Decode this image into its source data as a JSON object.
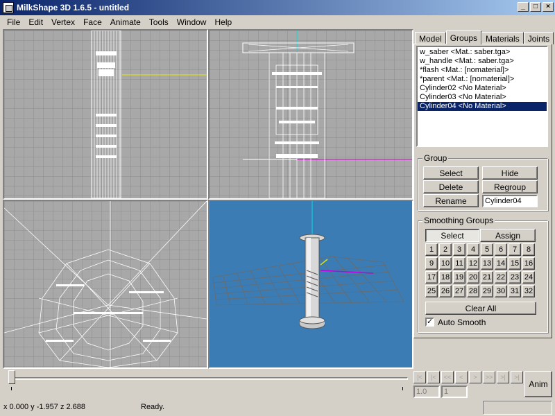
{
  "window": {
    "title": "MilkShape 3D 1.6.5 - untitled",
    "buttons": [
      "_",
      "□",
      "×"
    ]
  },
  "menu": [
    "File",
    "Edit",
    "Vertex",
    "Face",
    "Animate",
    "Tools",
    "Window",
    "Help"
  ],
  "tabs": [
    {
      "label": "Model",
      "active": false
    },
    {
      "label": "Groups",
      "active": true
    },
    {
      "label": "Materials",
      "active": false
    },
    {
      "label": "Joints",
      "active": false
    }
  ],
  "groups": [
    "w_saber <Mat.: saber.tga>",
    "w_handle <Mat.: saber.tga>",
    "*flash <Mat.: [nomaterial]>",
    "*parent <Mat.: [nomaterial]>",
    "Cylinder02 <No Material>",
    "Cylinder03 <No Material>",
    "Cylinder04 <No Material>"
  ],
  "selected_group": "Cylinder04 <No Material>",
  "group_box": {
    "legend": "Group",
    "select": "Select",
    "hide": "Hide",
    "delete": "Delete",
    "regroup": "Regroup",
    "rename": "Rename",
    "name_value": "Cylinder04"
  },
  "smoothing": {
    "legend": "Smoothing Groups",
    "select": "Select",
    "assign": "Assign",
    "numbers": [
      "1",
      "2",
      "3",
      "4",
      "5",
      "6",
      "7",
      "8",
      "9",
      "10",
      "11",
      "12",
      "13",
      "14",
      "15",
      "16",
      "17",
      "18",
      "19",
      "20",
      "21",
      "22",
      "23",
      "24",
      "25",
      "26",
      "27",
      "28",
      "29",
      "30",
      "31",
      "32"
    ],
    "clear_all": "Clear All",
    "auto_smooth": "Auto Smooth",
    "auto_smooth_checked": true
  },
  "timeline": {
    "nav_buttons": [
      "|<",
      "|<",
      "<<",
      "<",
      ">",
      ">>",
      ">|",
      ">|"
    ],
    "frame": "1.0",
    "total": "1",
    "anim": "Anim"
  },
  "status": {
    "coords": "x 0.000 y -1.957 z 2.688",
    "message": "Ready."
  },
  "colors": {
    "title_start": "#0a246a",
    "selection": "#0a246a",
    "viewport_bg": "#a8a8a8",
    "viewport_3d_bg": "#3b7cb4"
  }
}
